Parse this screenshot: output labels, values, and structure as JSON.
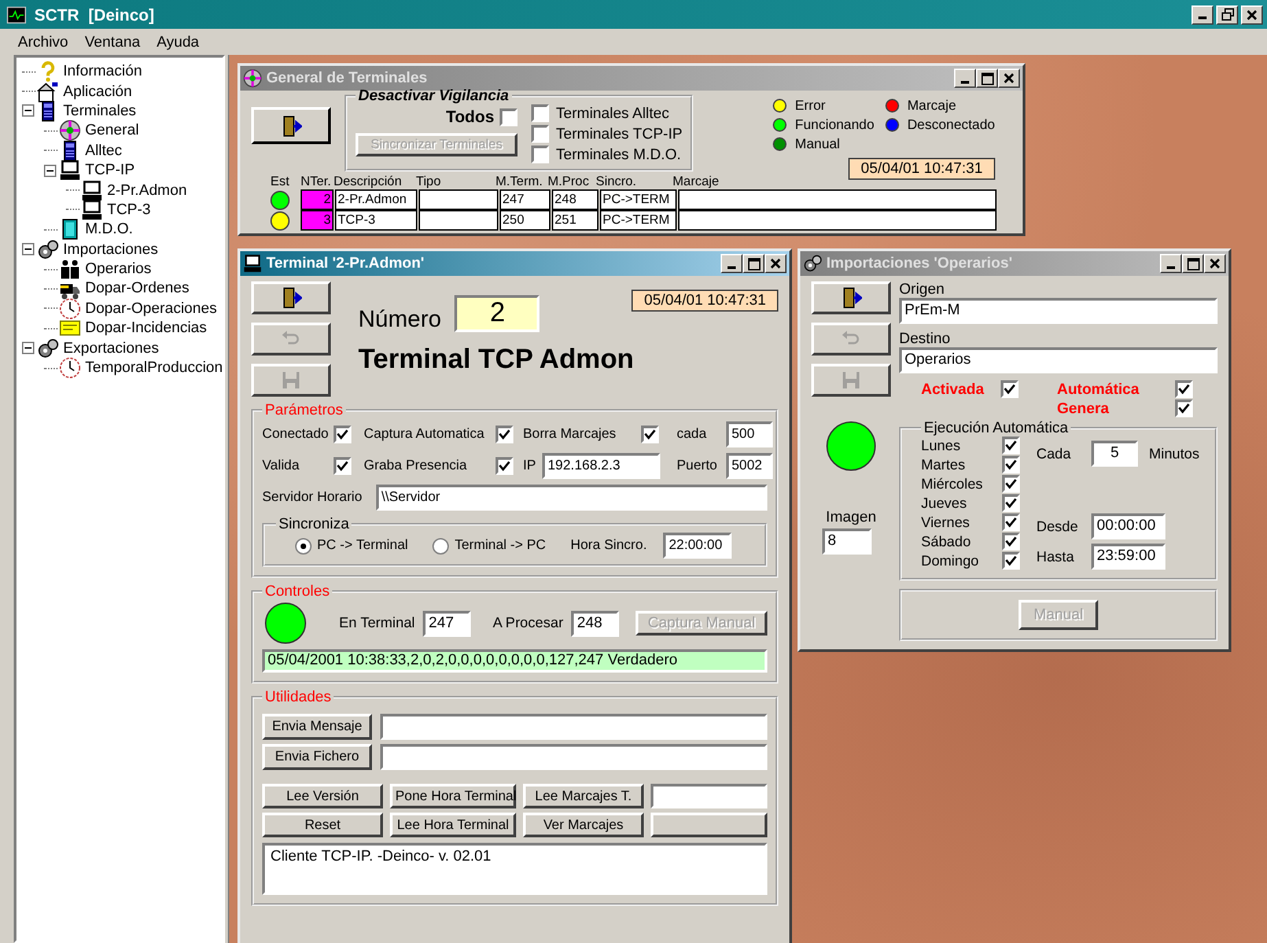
{
  "app": {
    "title": "SCTR  [Deinco]",
    "menu": [
      "Archivo",
      "Ventana",
      "Ayuda"
    ]
  },
  "tree": [
    {
      "label": "Información",
      "kind": "help"
    },
    {
      "label": "Aplicación",
      "kind": "app"
    },
    {
      "label": "Terminales",
      "kind": "device",
      "expanded": true,
      "children": [
        {
          "label": "General",
          "kind": "globe"
        },
        {
          "label": "Alltec",
          "kind": "device"
        },
        {
          "label": "TCP-IP",
          "kind": "pc",
          "expanded": true,
          "children": [
            {
              "label": "2-Pr.Admon",
              "kind": "pc"
            },
            {
              "label": "TCP-3",
              "kind": "pc"
            }
          ]
        },
        {
          "label": "M.D.O.",
          "kind": "door"
        }
      ]
    },
    {
      "label": "Importaciones",
      "kind": "gears",
      "expanded": true,
      "children": [
        {
          "label": "Operarios",
          "kind": "people"
        },
        {
          "label": "Dopar-Ordenes",
          "kind": "truck"
        },
        {
          "label": "Dopar-Operaciones",
          "kind": "clock"
        },
        {
          "label": "Dopar-Incidencias",
          "kind": "note"
        }
      ]
    },
    {
      "label": "Exportaciones",
      "kind": "gears",
      "expanded": true,
      "children": [
        {
          "label": "TemporalProduccion",
          "kind": "clock"
        }
      ]
    }
  ],
  "general": {
    "title": "General de Terminales",
    "active": false,
    "group_title": "Desactivar Vigilancia",
    "todos": {
      "label": "Todos",
      "checked": false
    },
    "sync_button": {
      "label": "Sincronizar Terminales",
      "disabled": true
    },
    "checkboxes": [
      {
        "label": "Terminales Alltec",
        "checked": false
      },
      {
        "label": "Terminales TCP-IP",
        "checked": false
      },
      {
        "label": "Terminales M.D.O.",
        "checked": false
      }
    ],
    "legend": [
      {
        "label": "Error",
        "color": "#ffff00"
      },
      {
        "label": "Funcionando",
        "color": "#00ff00"
      },
      {
        "label": "Manual",
        "color": "#009000"
      },
      {
        "label": "Marcaje",
        "color": "#ff0000"
      },
      {
        "label": "Desconectado",
        "color": "#0000ff"
      }
    ],
    "datetime": "05/04/01 10:47:31",
    "columns": [
      "Est",
      "NTer.",
      "Descripción",
      "Tipo",
      "M.Term.",
      "M.Proc",
      "Sincro.",
      "Marcaje"
    ],
    "rows": [
      {
        "color": "#00ff00",
        "nter": "2",
        "descripcion": "2-Pr.Admon",
        "m_term": "247",
        "m_proc": "248",
        "sincro": "PC->TERM"
      },
      {
        "color": "#ffff00",
        "nter": "3",
        "descripcion": "TCP-3",
        "m_term": "250",
        "m_proc": "251",
        "sincro": "PC->TERM"
      }
    ]
  },
  "terminal": {
    "title": "Terminal '2-Pr.Admon'",
    "active": true,
    "buttons": [
      {
        "kind": "exit",
        "disabled": false
      },
      {
        "kind": "undo",
        "disabled": true
      },
      {
        "kind": "save",
        "disabled": true
      }
    ],
    "numero_label": "Número",
    "numero": "2",
    "datetime": "05/04/01 10:47:31",
    "name": "Terminal TCP Admon",
    "parametros": {
      "title": "Parámetros",
      "conectado": {
        "label": "Conectado",
        "checked": true
      },
      "captura": {
        "label": "Captura Automatica",
        "checked": true
      },
      "borra": {
        "label": "Borra Marcajes",
        "checked": true
      },
      "cada_label": "cada",
      "cada": "500",
      "valida": {
        "label": "Valida",
        "checked": true
      },
      "graba": {
        "label": "Graba Presencia",
        "checked": true
      },
      "ip_label": "IP",
      "ip": "192.168.2.3",
      "puerto_label": "Puerto",
      "puerto": "5002",
      "servidor_label": "Servidor Horario",
      "servidor": "\\\\Servidor",
      "sincroniza_title": "Sincroniza",
      "radios": [
        {
          "label": "PC -> Terminal",
          "selected": true
        },
        {
          "label": "Terminal -> PC",
          "selected": false
        }
      ],
      "hora_label": "Hora Sincro.",
      "hora": "22:00:00"
    },
    "controles": {
      "title": "Controles",
      "color": "#00ff00",
      "en_terminal_label": "En Terminal",
      "en_terminal": "247",
      "a_procesar_label": "A Procesar",
      "a_procesar": "248",
      "captura_button": {
        "label": "Captura Manual",
        "disabled": true
      },
      "log": "05/04/2001 10:38:33,2,0,2,0,0,0,0,0,0,0,0,127,247 Verdadero"
    },
    "utilidades": {
      "title": "Utilidades",
      "send_buttons": [
        "Envia Mensaje",
        "Envia Fichero"
      ],
      "buttons": [
        [
          "Lee Versión",
          "Pone Hora Terminal",
          "Lee Marcajes T."
        ],
        [
          "Reset",
          "Lee Hora Terminal",
          "Ver Marcajes"
        ]
      ],
      "output": "Cliente TCP-IP. -Deinco- v. 02.01"
    }
  },
  "importaciones": {
    "title": "Importaciones 'Operarios'",
    "active": false,
    "buttons": [
      {
        "kind": "exit",
        "disabled": false
      },
      {
        "kind": "undo",
        "disabled": true
      },
      {
        "kind": "save",
        "disabled": true
      }
    ],
    "origen_label": "Origen",
    "origen": "PrEm-M",
    "destino_label": "Destino",
    "destino": "Operarios",
    "flags": [
      {
        "label": "Activada",
        "checked": true
      },
      {
        "label": "Automática",
        "checked": true
      },
      {
        "label": "Genera",
        "checked": true
      }
    ],
    "color": "#00ff00",
    "imagen_label": "Imagen",
    "imagen": "8",
    "group_title": "Ejecución Automática",
    "days": [
      {
        "label": "Lunes",
        "checked": true
      },
      {
        "label": "Martes",
        "checked": true
      },
      {
        "label": "Miércoles",
        "checked": true
      },
      {
        "label": "Jueves",
        "checked": true
      },
      {
        "label": "Viernes",
        "checked": true
      },
      {
        "label": "Sábado",
        "checked": true
      },
      {
        "label": "Domingo",
        "checked": true
      }
    ],
    "cada_label": "Cada",
    "cada": "5",
    "minutos_label": "Minutos",
    "desde_label": "Desde",
    "desde": "00:00:00",
    "hasta_label": "Hasta",
    "hasta": "23:59:00",
    "manual_button": {
      "label": "Manual",
      "disabled": true
    }
  }
}
